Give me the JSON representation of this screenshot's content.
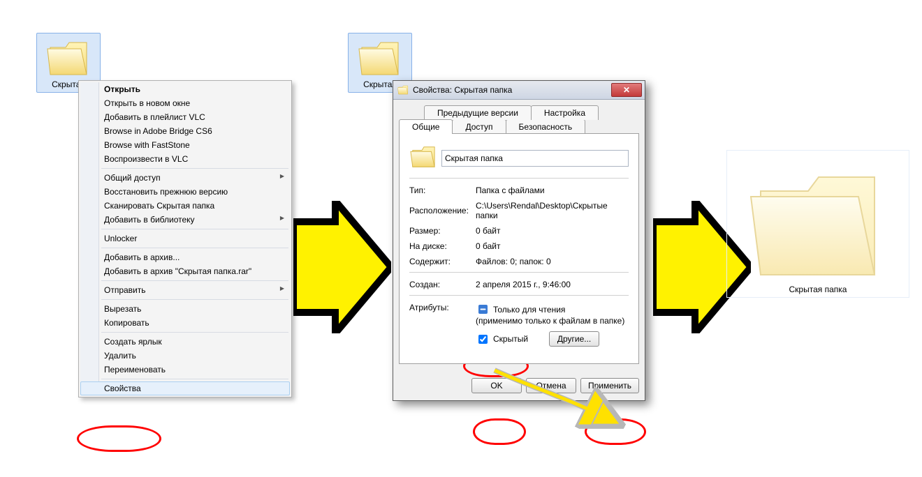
{
  "desktop": {
    "folder_left_label": "Скрытая",
    "folder_mid_label": "Скрытая",
    "folder_right_label": "Скрытая папка"
  },
  "context_menu": {
    "open": "Открыть",
    "open_new_window": "Открыть в новом окне",
    "vlc_playlist": "Добавить в плейлист VLC",
    "adobe_bridge": "Browse in Adobe Bridge CS6",
    "faststone": "Browse with FastStone",
    "vlc_play": "Воспроизвести в VLC",
    "share": "Общий доступ",
    "restore_prev": "Восстановить прежнюю версию",
    "scan": "Сканировать Скрытая папка",
    "library_add": "Добавить в библиотеку",
    "unlocker": "Unlocker",
    "archive_add": "Добавить в архив...",
    "archive_add_rar": "Добавить в архив \"Скрытая папка.rar\"",
    "send_to": "Отправить",
    "cut": "Вырезать",
    "copy": "Копировать",
    "shortcut": "Создать ярлык",
    "delete": "Удалить",
    "rename": "Переименовать",
    "properties": "Свойства"
  },
  "dialog": {
    "title": "Свойства: Скрытая папка",
    "tabs": {
      "prev_versions": "Предыдущие версии",
      "customize": "Настройка",
      "general": "Общие",
      "sharing": "Доступ",
      "security": "Безопасность"
    },
    "name_value": "Скрытая папка",
    "type_k": "Тип:",
    "type_v": "Папка с файлами",
    "loc_k": "Расположение:",
    "loc_v": "C:\\Users\\Rendal\\Desktop\\Скрытые папки",
    "size_k": "Размер:",
    "size_v": "0 байт",
    "disk_k": "На диске:",
    "disk_v": "0 байт",
    "contains_k": "Содержит:",
    "contains_v": "Файлов: 0; папок: 0",
    "created_k": "Создан:",
    "created_v": "2 апреля 2015 г., 9:46:00",
    "attr_k": "Атрибуты:",
    "readonly_label": "Только для чтения",
    "readonly_note": "(применимо только к файлам в папке)",
    "hidden_label": "Скрытый",
    "other_btn": "Другие...",
    "ok": "OK",
    "cancel": "Отмена",
    "apply": "Применить"
  }
}
